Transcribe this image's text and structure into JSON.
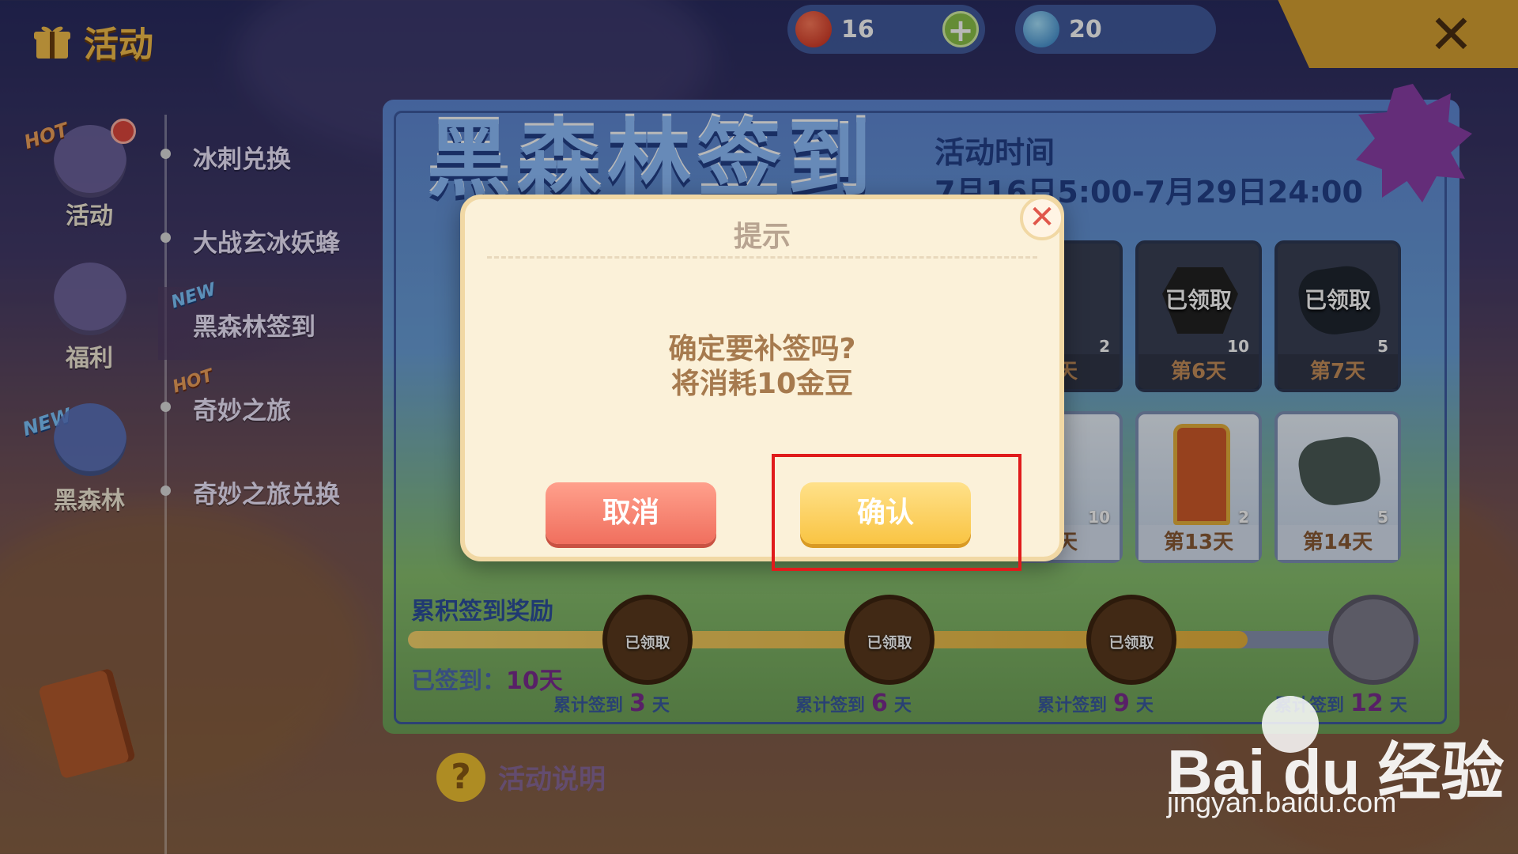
{
  "header": {
    "title": "活动",
    "resources": [
      {
        "icon": "red-bean-icon",
        "value": "16",
        "has_plus": true
      },
      {
        "icon": "blue-gem-icon",
        "value": "20",
        "has_plus": false
      }
    ]
  },
  "nav": {
    "items": [
      {
        "label": "活动",
        "tag": "HOT",
        "has_dot": true,
        "icon": "gift-icon"
      },
      {
        "label": "福利",
        "tag": "",
        "has_dot": false,
        "icon": "heart-icon"
      },
      {
        "label": "黑森林",
        "tag": "NEW",
        "has_dot": false,
        "icon": "swirl-portal-icon"
      }
    ]
  },
  "menu": {
    "items": [
      {
        "label": "冰刺兑换",
        "tag": ""
      },
      {
        "label": "大战玄冰妖蜂",
        "tag": ""
      },
      {
        "label": "黑森林签到",
        "tag": "NEW",
        "selected": true
      },
      {
        "label": "奇妙之旅",
        "tag": "HOT"
      },
      {
        "label": "奇妙之旅兑换",
        "tag": ""
      }
    ]
  },
  "event": {
    "banner_title": "黑森林签到",
    "time_title": "活动时间",
    "time_range": "7月16日5:00-7月29日24:00",
    "cards_top": [
      {
        "status": "取",
        "count": "2",
        "day": "天"
      },
      {
        "status": "已领取",
        "count": "10",
        "day": "第6天"
      },
      {
        "status": "已领取",
        "count": "5",
        "day": "第7天"
      }
    ],
    "cards_bottom": [
      {
        "count": "10",
        "day": "天"
      },
      {
        "count": "2",
        "day": "第13天"
      },
      {
        "count": "5",
        "day": "第14天"
      }
    ]
  },
  "rewards": {
    "title": "累积签到奖励",
    "signed_label": "已签到：",
    "signed_value": "10天",
    "progress": 0.83,
    "milestones": [
      {
        "claimed": "已领取",
        "prefix": "累计签到",
        "days": "3",
        "suffix": "天"
      },
      {
        "claimed": "已领取",
        "prefix": "累计签到",
        "days": "6",
        "suffix": "天"
      },
      {
        "claimed": "已领取",
        "prefix": "累计签到",
        "days": "9",
        "suffix": "天"
      },
      {
        "claimed": "",
        "prefix": "累计签到",
        "days": "12",
        "suffix": "天"
      }
    ]
  },
  "help": {
    "label": "活动说明"
  },
  "modal": {
    "title": "提示",
    "line1": "确定要补签吗?",
    "line2": "将消耗10金豆",
    "cancel": "取消",
    "confirm": "确认"
  },
  "watermark": {
    "logo": "Bai du 经验",
    "url": "jingyan.baidu.com"
  }
}
